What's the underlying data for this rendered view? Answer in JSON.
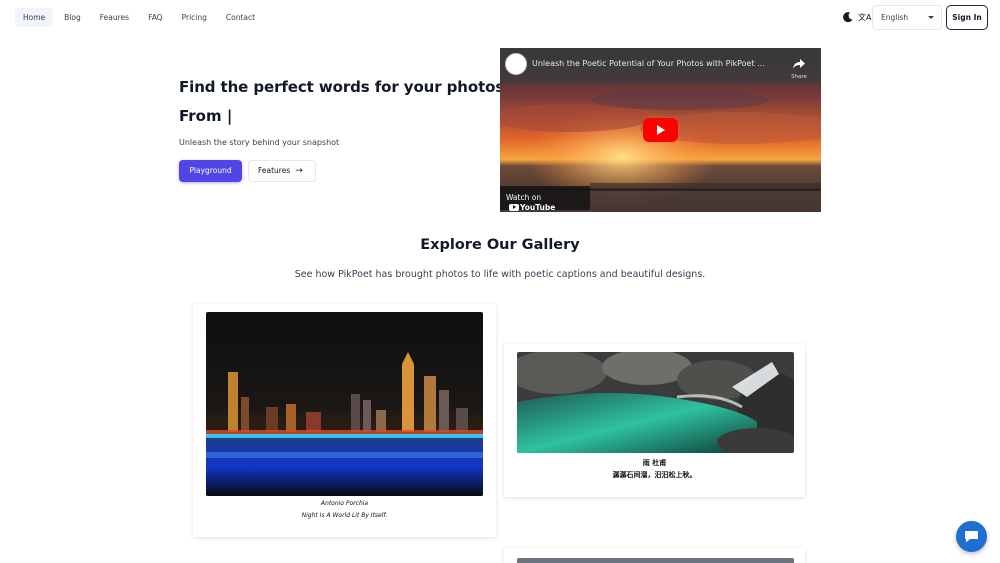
{
  "nav": {
    "links": [
      "Home",
      "Blog",
      "Feaures",
      "FAQ",
      "Pricing",
      "Contact"
    ],
    "active": "Home",
    "theme_icon": "moon-icon",
    "translate_icon": "translate-icon",
    "translate_glyph": "文A",
    "language": "English",
    "signin_label": "Sign In"
  },
  "hero": {
    "title": "Find the perfect words for your photos",
    "typing": "From |",
    "subtitle": "Unleash the story behind your snapshot",
    "primary_button": "Playground",
    "secondary_button": "Features",
    "secondary_icon": "arrow-right-icon"
  },
  "video": {
    "title": "Unleash the Poetic Potential of Your Photos with PikPoet ...",
    "share_label": "Share",
    "watch_on": "Watch on",
    "youtube_label": "YouTube"
  },
  "gallery": {
    "title": "Explore Our Gallery",
    "subtitle": "See how PikPoet has brought photos to life with poetic captions and beautiful designs.",
    "cards": [
      {
        "caption_line1": "Antonio Porchia",
        "caption_line2": "Night Is A World Lit By Itself."
      },
      {
        "caption_line1": "雨 杜甫",
        "caption_line2": "潺潺石间溜，汩汩松上秋。"
      }
    ]
  },
  "colors": {
    "primary": "#4f46e5",
    "chat": "#1d6fd1"
  }
}
